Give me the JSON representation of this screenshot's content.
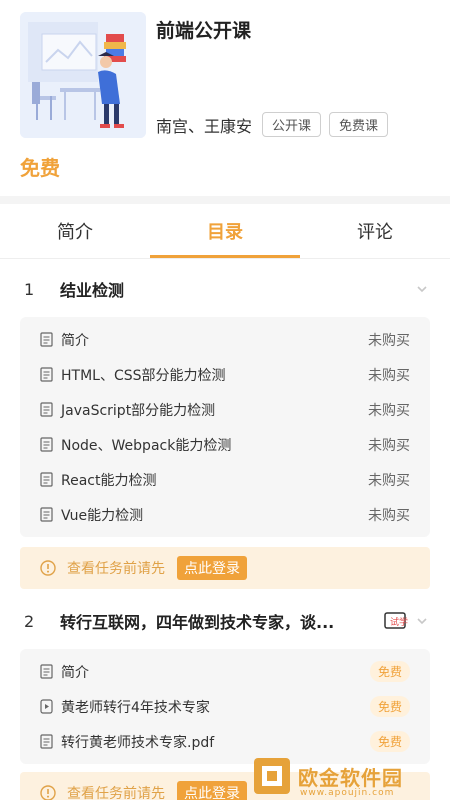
{
  "course": {
    "title": "前端公开课",
    "teachers": "南宫、王康安",
    "tags": [
      "公开课",
      "免费课"
    ],
    "price": "免费"
  },
  "tabs": [
    {
      "label": "简介",
      "active": false
    },
    {
      "label": "目录",
      "active": true
    },
    {
      "label": "评论",
      "active": false
    }
  ],
  "sections": [
    {
      "num": "1",
      "title": "结业检测",
      "lessons": [
        {
          "icon": "doc-icon",
          "label": "简介",
          "status": "未购买"
        },
        {
          "icon": "doc-icon",
          "label": "HTML、CSS部分能力检测",
          "status": "未购买"
        },
        {
          "icon": "doc-icon",
          "label": "JavaScript部分能力检测",
          "status": "未购买"
        },
        {
          "icon": "doc-icon",
          "label": "Node、Webpack能力检测",
          "status": "未购买"
        },
        {
          "icon": "doc-icon",
          "label": "React能力检测",
          "status": "未购买"
        },
        {
          "icon": "doc-icon",
          "label": "Vue能力检测",
          "status": "未购买"
        }
      ]
    },
    {
      "num": "2",
      "title": "转行互联网，四年做到技术专家，谈...",
      "trial_label": "试学",
      "lessons": [
        {
          "icon": "doc-icon",
          "label": "简介",
          "status": "免费"
        },
        {
          "icon": "video-icon",
          "label": "黄老师转行4年技术专家",
          "status": "免费"
        },
        {
          "icon": "doc-icon",
          "label": "转行黄老师技术专家.pdf",
          "status": "免费"
        }
      ]
    }
  ],
  "login_prompt": {
    "text": "查看任务前请先",
    "button": "点此登录"
  },
  "watermark": {
    "text": "欧金软件园",
    "sub": "www.apoujin.com"
  },
  "colors": {
    "accent": "#f0a23a",
    "panel": "#f6f6f6",
    "login_bg": "#fdf1df"
  }
}
